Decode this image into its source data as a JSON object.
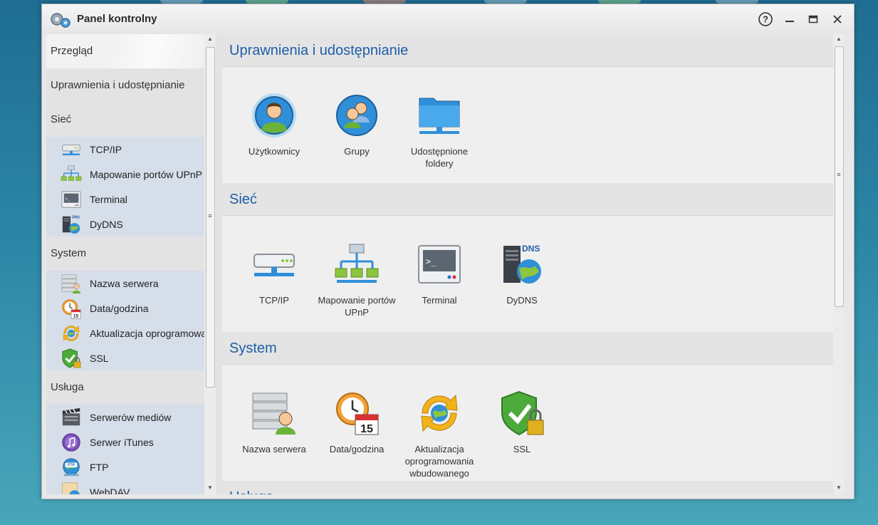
{
  "window": {
    "title": "Panel kontrolny",
    "controls": [
      "help-icon",
      "minimize-icon",
      "maximize-icon",
      "close-icon"
    ]
  },
  "sidebar": {
    "overview": "Przegląd",
    "permissions": "Uprawnienia i udostępnianie",
    "network": {
      "label": "Sieć",
      "items": [
        {
          "label": "TCP/IP",
          "icon": "network-adapter-icon"
        },
        {
          "label": "Mapowanie portów UPnP",
          "icon": "upnp-network-icon"
        },
        {
          "label": "Terminal",
          "icon": "terminal-icon"
        },
        {
          "label": "DyDNS",
          "icon": "dns-server-icon"
        }
      ]
    },
    "system": {
      "label": "System",
      "items": [
        {
          "label": "Nazwa serwera",
          "icon": "server-name-icon"
        },
        {
          "label": "Data/godzina",
          "icon": "clock-calendar-icon"
        },
        {
          "label": "Aktualizacja oprogramowa",
          "icon": "firmware-update-icon"
        },
        {
          "label": "SSL",
          "icon": "ssl-shield-icon"
        }
      ]
    },
    "service": {
      "label": "Usługa",
      "items": [
        {
          "label": "Serwerów mediów",
          "icon": "media-server-icon"
        },
        {
          "label": "Serwer iTunes",
          "icon": "itunes-icon"
        },
        {
          "label": "FTP",
          "icon": "ftp-icon"
        },
        {
          "label": "WebDAV",
          "icon": "webdav-icon"
        }
      ]
    }
  },
  "main": {
    "sections": [
      {
        "title": "Uprawnienia i udostępnianie",
        "tiles": [
          {
            "label": "Użytkownicy",
            "icon": "user-icon"
          },
          {
            "label": "Grupy",
            "icon": "group-icon"
          },
          {
            "label": "Udostępnione foldery",
            "icon": "shared-folder-icon"
          }
        ]
      },
      {
        "title": "Sieć",
        "tiles": [
          {
            "label": "TCP/IP",
            "icon": "network-adapter-icon"
          },
          {
            "label": "Mapowanie portów UPnP",
            "icon": "upnp-network-icon"
          },
          {
            "label": "Terminal",
            "icon": "terminal-icon"
          },
          {
            "label": "DyDNS",
            "icon": "dns-server-icon"
          }
        ]
      },
      {
        "title": "System",
        "tiles": [
          {
            "label": "Nazwa serwera",
            "icon": "server-name-icon"
          },
          {
            "label": "Data/godzina",
            "icon": "clock-calendar-icon"
          },
          {
            "label": "Aktualizacja oprogramowania wbudowanego",
            "icon": "firmware-update-icon"
          },
          {
            "label": "SSL",
            "icon": "ssl-shield-icon"
          }
        ]
      },
      {
        "title": "Usługa"
      }
    ]
  },
  "calendar_day": "15",
  "dns_badge": "DNS",
  "ftp_badge": "FTP",
  "colors": {
    "accent": "#1f5ea8",
    "sidebar_group_bg": "#d6dee9",
    "desktop": "#2b86a6"
  }
}
